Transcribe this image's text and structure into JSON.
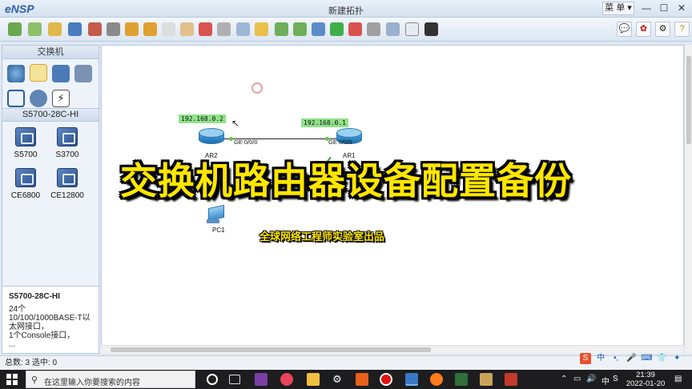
{
  "window": {
    "app_name": "eNSP",
    "title": "新建拓扑",
    "menu_label": "菜 单",
    "controls": [
      "—",
      "☐",
      "✕"
    ]
  },
  "left_panel": {
    "category_header": "交换机",
    "device_subheader": "S5700-28C-HI",
    "devices": [
      {
        "label": "S5700",
        "icon": "switch-icon"
      },
      {
        "label": "S3700",
        "icon": "switch-icon"
      },
      {
        "label": "CE6800",
        "icon": "switch-icon"
      },
      {
        "label": "CE12800",
        "icon": "switch-icon"
      }
    ],
    "description": {
      "title": "S5700-28C-HI",
      "lines": [
        "24个 10/100/1000BASE-T以",
        "太网接口，",
        "1个Console接口，",
        "..."
      ]
    }
  },
  "topology": {
    "ip_ar2": "192.168.0.2",
    "ip_ar1": "192.168.0.1",
    "node_ar2": "AR2",
    "node_ar1": "AR1",
    "node_pc1": "PC1",
    "port_ar2": "GE 0/0/0",
    "port_ar1": "GE 0/0/0"
  },
  "overlay": {
    "title": "交换机路由器设备配置备份",
    "subtitle": "全球网络工程师实验室出品"
  },
  "status_bar": {
    "text": "总数: 3  选中: 0"
  },
  "ime_bar": {
    "items": [
      "S",
      "中",
      "•,",
      "🎤",
      "⌨",
      "👕",
      "✦"
    ]
  },
  "taskbar": {
    "search_placeholder": "在这里输入你要搜索的内容",
    "tray_lang": "中",
    "time": "21:39",
    "date": "2022-01-20"
  },
  "colors": {
    "overlay_text": "#ffe600",
    "ip_label_bg": "#90e28a",
    "router_blue": "#1d6fae"
  }
}
